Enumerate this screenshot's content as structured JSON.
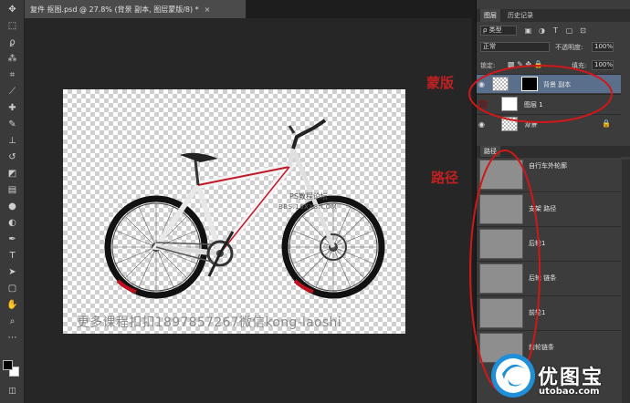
{
  "document": {
    "tab_title": "复件 抠图.psd @ 27.8% (背景 副本, 图层蒙版/8) *",
    "close_glyph": "×"
  },
  "toolbar": {
    "tools": [
      "move",
      "marquee",
      "lasso",
      "magic-wand",
      "crop",
      "eyedropper",
      "healing",
      "brush",
      "clone-stamp",
      "history-brush",
      "eraser",
      "gradient",
      "blur",
      "dodge",
      "pen",
      "type",
      "path-selection",
      "shape",
      "hand",
      "zoom"
    ],
    "foreground_color": "#000000",
    "background_color": "#ffffff"
  },
  "layers_panel": {
    "tabs": [
      "图层",
      "历史记录"
    ],
    "filter_label": "ρ 类型",
    "blend_mode": "正常",
    "opacity_label": "不透明度:",
    "opacity_value": "100%",
    "lock_label": "锁定:",
    "fill_label": "填充:",
    "fill_value": "100%",
    "layers": [
      {
        "name": "背景 副本",
        "selected": true,
        "visible": true
      },
      {
        "name": "图层 1",
        "selected": false,
        "visible": false
      },
      {
        "name": "背景",
        "selected": false,
        "visible": true,
        "locked": true
      }
    ]
  },
  "paths_panel": {
    "tab": "路径",
    "paths": [
      "自行车外轮廓",
      "支架 路径",
      "后轮1",
      "后轮 链条",
      "前轮1",
      "前轮链条"
    ]
  },
  "canvas_watermarks": {
    "forum": "PS教程论坛",
    "url": "BBS.16XX8.COM",
    "bottom": "更多课程扣扣1897857267微信kong-laoshi"
  },
  "annotations": {
    "mask": "蒙版",
    "paths": "路径",
    "color": "#c02020"
  },
  "branding": {
    "name": "优图宝",
    "url": "utobao.com"
  }
}
